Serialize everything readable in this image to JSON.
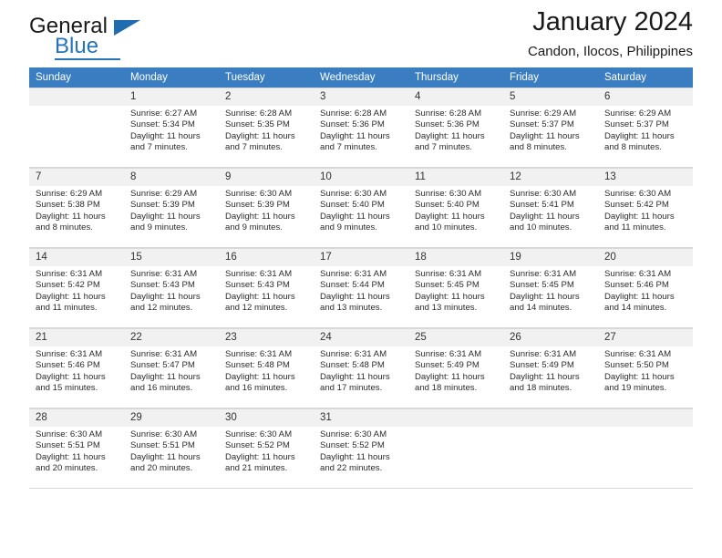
{
  "brand": {
    "line1": "General",
    "line2": "Blue",
    "accent_color": "#2573b8",
    "triangle_icon": "brand-triangle-icon"
  },
  "header": {
    "title": "January 2024",
    "subtitle": "Candon, Ilocos, Philippines"
  },
  "calendar": {
    "weekday_headers": [
      "Sunday",
      "Monday",
      "Tuesday",
      "Wednesday",
      "Thursday",
      "Friday",
      "Saturday"
    ],
    "header_bg": "#3a7dc0",
    "weeks": [
      [
        {
          "day": "",
          "sunrise": "",
          "sunset": "",
          "daylight1": "",
          "daylight2": ""
        },
        {
          "day": "1",
          "sunrise": "Sunrise: 6:27 AM",
          "sunset": "Sunset: 5:34 PM",
          "daylight1": "Daylight: 11 hours",
          "daylight2": "and 7 minutes."
        },
        {
          "day": "2",
          "sunrise": "Sunrise: 6:28 AM",
          "sunset": "Sunset: 5:35 PM",
          "daylight1": "Daylight: 11 hours",
          "daylight2": "and 7 minutes."
        },
        {
          "day": "3",
          "sunrise": "Sunrise: 6:28 AM",
          "sunset": "Sunset: 5:36 PM",
          "daylight1": "Daylight: 11 hours",
          "daylight2": "and 7 minutes."
        },
        {
          "day": "4",
          "sunrise": "Sunrise: 6:28 AM",
          "sunset": "Sunset: 5:36 PM",
          "daylight1": "Daylight: 11 hours",
          "daylight2": "and 7 minutes."
        },
        {
          "day": "5",
          "sunrise": "Sunrise: 6:29 AM",
          "sunset": "Sunset: 5:37 PM",
          "daylight1": "Daylight: 11 hours",
          "daylight2": "and 8 minutes."
        },
        {
          "day": "6",
          "sunrise": "Sunrise: 6:29 AM",
          "sunset": "Sunset: 5:37 PM",
          "daylight1": "Daylight: 11 hours",
          "daylight2": "and 8 minutes."
        }
      ],
      [
        {
          "day": "7",
          "sunrise": "Sunrise: 6:29 AM",
          "sunset": "Sunset: 5:38 PM",
          "daylight1": "Daylight: 11 hours",
          "daylight2": "and 8 minutes."
        },
        {
          "day": "8",
          "sunrise": "Sunrise: 6:29 AM",
          "sunset": "Sunset: 5:39 PM",
          "daylight1": "Daylight: 11 hours",
          "daylight2": "and 9 minutes."
        },
        {
          "day": "9",
          "sunrise": "Sunrise: 6:30 AM",
          "sunset": "Sunset: 5:39 PM",
          "daylight1": "Daylight: 11 hours",
          "daylight2": "and 9 minutes."
        },
        {
          "day": "10",
          "sunrise": "Sunrise: 6:30 AM",
          "sunset": "Sunset: 5:40 PM",
          "daylight1": "Daylight: 11 hours",
          "daylight2": "and 9 minutes."
        },
        {
          "day": "11",
          "sunrise": "Sunrise: 6:30 AM",
          "sunset": "Sunset: 5:40 PM",
          "daylight1": "Daylight: 11 hours",
          "daylight2": "and 10 minutes."
        },
        {
          "day": "12",
          "sunrise": "Sunrise: 6:30 AM",
          "sunset": "Sunset: 5:41 PM",
          "daylight1": "Daylight: 11 hours",
          "daylight2": "and 10 minutes."
        },
        {
          "day": "13",
          "sunrise": "Sunrise: 6:30 AM",
          "sunset": "Sunset: 5:42 PM",
          "daylight1": "Daylight: 11 hours",
          "daylight2": "and 11 minutes."
        }
      ],
      [
        {
          "day": "14",
          "sunrise": "Sunrise: 6:31 AM",
          "sunset": "Sunset: 5:42 PM",
          "daylight1": "Daylight: 11 hours",
          "daylight2": "and 11 minutes."
        },
        {
          "day": "15",
          "sunrise": "Sunrise: 6:31 AM",
          "sunset": "Sunset: 5:43 PM",
          "daylight1": "Daylight: 11 hours",
          "daylight2": "and 12 minutes."
        },
        {
          "day": "16",
          "sunrise": "Sunrise: 6:31 AM",
          "sunset": "Sunset: 5:43 PM",
          "daylight1": "Daylight: 11 hours",
          "daylight2": "and 12 minutes."
        },
        {
          "day": "17",
          "sunrise": "Sunrise: 6:31 AM",
          "sunset": "Sunset: 5:44 PM",
          "daylight1": "Daylight: 11 hours",
          "daylight2": "and 13 minutes."
        },
        {
          "day": "18",
          "sunrise": "Sunrise: 6:31 AM",
          "sunset": "Sunset: 5:45 PM",
          "daylight1": "Daylight: 11 hours",
          "daylight2": "and 13 minutes."
        },
        {
          "day": "19",
          "sunrise": "Sunrise: 6:31 AM",
          "sunset": "Sunset: 5:45 PM",
          "daylight1": "Daylight: 11 hours",
          "daylight2": "and 14 minutes."
        },
        {
          "day": "20",
          "sunrise": "Sunrise: 6:31 AM",
          "sunset": "Sunset: 5:46 PM",
          "daylight1": "Daylight: 11 hours",
          "daylight2": "and 14 minutes."
        }
      ],
      [
        {
          "day": "21",
          "sunrise": "Sunrise: 6:31 AM",
          "sunset": "Sunset: 5:46 PM",
          "daylight1": "Daylight: 11 hours",
          "daylight2": "and 15 minutes."
        },
        {
          "day": "22",
          "sunrise": "Sunrise: 6:31 AM",
          "sunset": "Sunset: 5:47 PM",
          "daylight1": "Daylight: 11 hours",
          "daylight2": "and 16 minutes."
        },
        {
          "day": "23",
          "sunrise": "Sunrise: 6:31 AM",
          "sunset": "Sunset: 5:48 PM",
          "daylight1": "Daylight: 11 hours",
          "daylight2": "and 16 minutes."
        },
        {
          "day": "24",
          "sunrise": "Sunrise: 6:31 AM",
          "sunset": "Sunset: 5:48 PM",
          "daylight1": "Daylight: 11 hours",
          "daylight2": "and 17 minutes."
        },
        {
          "day": "25",
          "sunrise": "Sunrise: 6:31 AM",
          "sunset": "Sunset: 5:49 PM",
          "daylight1": "Daylight: 11 hours",
          "daylight2": "and 18 minutes."
        },
        {
          "day": "26",
          "sunrise": "Sunrise: 6:31 AM",
          "sunset": "Sunset: 5:49 PM",
          "daylight1": "Daylight: 11 hours",
          "daylight2": "and 18 minutes."
        },
        {
          "day": "27",
          "sunrise": "Sunrise: 6:31 AM",
          "sunset": "Sunset: 5:50 PM",
          "daylight1": "Daylight: 11 hours",
          "daylight2": "and 19 minutes."
        }
      ],
      [
        {
          "day": "28",
          "sunrise": "Sunrise: 6:30 AM",
          "sunset": "Sunset: 5:51 PM",
          "daylight1": "Daylight: 11 hours",
          "daylight2": "and 20 minutes."
        },
        {
          "day": "29",
          "sunrise": "Sunrise: 6:30 AM",
          "sunset": "Sunset: 5:51 PM",
          "daylight1": "Daylight: 11 hours",
          "daylight2": "and 20 minutes."
        },
        {
          "day": "30",
          "sunrise": "Sunrise: 6:30 AM",
          "sunset": "Sunset: 5:52 PM",
          "daylight1": "Daylight: 11 hours",
          "daylight2": "and 21 minutes."
        },
        {
          "day": "31",
          "sunrise": "Sunrise: 6:30 AM",
          "sunset": "Sunset: 5:52 PM",
          "daylight1": "Daylight: 11 hours",
          "daylight2": "and 22 minutes."
        },
        {
          "day": "",
          "sunrise": "",
          "sunset": "",
          "daylight1": "",
          "daylight2": ""
        },
        {
          "day": "",
          "sunrise": "",
          "sunset": "",
          "daylight1": "",
          "daylight2": ""
        },
        {
          "day": "",
          "sunrise": "",
          "sunset": "",
          "daylight1": "",
          "daylight2": ""
        }
      ]
    ]
  }
}
